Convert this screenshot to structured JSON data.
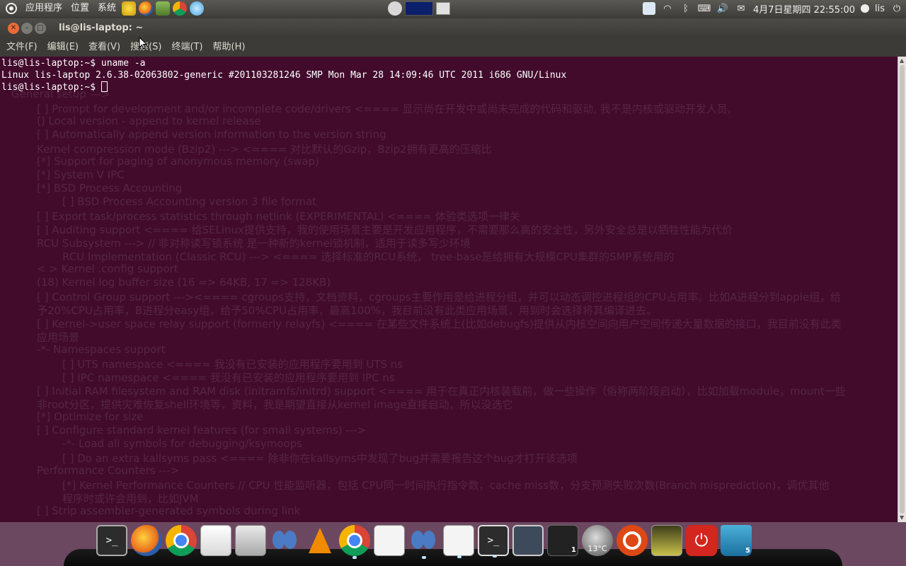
{
  "top_panel": {
    "menus": [
      "应用程序",
      "位置",
      "系统"
    ],
    "clock": "4月7日星期四 22:55:00",
    "user": "lis"
  },
  "window": {
    "title": "lis@lis-laptop: ~",
    "close_icon": "close-icon",
    "minimize_icon": "minimize-icon",
    "maximize_icon": "maximize-icon"
  },
  "menubar": {
    "items": [
      "文件(F)",
      "编辑(E)",
      "查看(V)",
      "搜索(S)",
      "终端(T)",
      "帮助(H)"
    ]
  },
  "terminal": {
    "lines": [
      "lis@lis-laptop:~$ uname -a",
      "Linux lis-laptop 2.6.38-02063802-generic #201103281246 SMP Mon Mar 28 14:09:46 UTC 2011 i686 GNU/Linux",
      "lis@lis-laptop:~$ "
    ],
    "background": "#420b2c",
    "foreground": "#ffffff"
  },
  "background_page": [
    "General setup --->",
    "[ ] Prompt for development and/or incomplete code/drivers <==== 显示尚在开发中或尚未完成的代码和驱动, 我不是内核或驱动开发人员,",
    "() Local version - append to kernel release",
    "[ ] Automatically append version information to the version string",
    "Kernel compression mode (Bzip2) ---> <==== 对比默认的Gzip，Bzip2拥有更高的压缩比",
    "[*] Support for paging of anonymous memory (swap)",
    "[*] System V IPC",
    "[*] BSD Process Accounting",
    "[ ] BSD Process Accounting version 3 file format",
    "[ ] Export task/process statistics through netlink (EXPERIMENTAL) <==== 体验类选项一律关",
    "[ ] Auditing support <==== 给SELinux提供支持，我的使用场景主要是开发应用程序，不需要那么高的安全性，另外安全总是以牺牲性能为代价",
    "RCU Subsystem ---> // 非对称读写锁系统 是一种新的kernel锁机制，适用于读多写少环境",
    "RCU Implementation (Classic RCU) ---> <==== 选择标准的RCU系统， tree-base是给拥有大规模CPU集群的SMP系统用的",
    "< > Kernel .config support",
    "(18) Kernel log buffer size (16 => 64KB, 17 => 128KB)",
    "[ ] Control Group support ---><==== cgroups支持，文档资料，cgroups主要作用是给进程分组，并可以动态调控进程组的CPU占用率。比如A进程分到apple组，给",
    "予20%CPU占用率，B进程分easy组，给予50%CPU占用率，最高100%，我目前没有此类应用场景，用到时会选择将其编译进去。",
    "[ ] Kernel->user space relay support (formerly relayfs) <==== 在某些文件系统上(比如debugfs)提供从内核空间向用户空间传递大量数据的接口，我目前没有此类",
    "应用场景",
    "-*- Namespaces support",
    "[ ] UTS namespace <==== 我没有已安装的应用程序要用到 UTS ns",
    "[ ] IPC namespace <==== 我没有已安装的应用程序要用到 IPC ns",
    "[ ] Initial RAM filesystem and RAM disk (initramfs/initrd) support <==== 用于在真正内核装载前，做一些操作（俗称两阶段启动），比如加载module，mount一些",
    "非root分区，提供灾难恢复shell环境等，资料，我是期望直接从kernel image直接启动，所以没选它",
    "[*] Optimize for size",
    "[ ] Configure standard kernel features (for small systems) --->",
    "-*- Load all symbols for debugging/ksymoops",
    "[ ] Do an extra kallsyms pass <==== 除非你在kallsyms中发现了bug并需要报告这个bug才打开该选项",
    "Performance Counters --->",
    "[*] Kernel Performance Counters // CPU 性能监听器，包括 CPU同一时间执行指令数，cache miss数，分支预测失败次数(Branch misprediction)，调优其他",
    "程序时或许会用到，比如JVM",
    "[ ] Strip assembler-generated symbols during link"
  ],
  "dock": {
    "items": [
      {
        "name": "terminal-icon",
        "label": ">_"
      },
      {
        "name": "firefox-icon"
      },
      {
        "name": "chrome-icon"
      },
      {
        "name": "mail-icon"
      },
      {
        "name": "calculator-icon"
      },
      {
        "name": "pidgin-icon"
      },
      {
        "name": "vlc-icon"
      },
      {
        "name": "chrome-window-icon"
      },
      {
        "name": "pidgin-window-icon"
      },
      {
        "name": "firefox-window-icon"
      },
      {
        "name": "terminal-window-icon"
      },
      {
        "name": "display-icon"
      },
      {
        "name": "workspace-switcher-icon",
        "badge": "1"
      },
      {
        "name": "weather-icon",
        "temperature": "13°C"
      },
      {
        "name": "ubuntu-icon"
      },
      {
        "name": "photo-icon"
      },
      {
        "name": "power-icon"
      },
      {
        "name": "trash-icon",
        "badge": "5"
      }
    ]
  },
  "colors": {
    "panel": "#3c3b37",
    "terminal_bg": "#420b2c",
    "close_button": "#e96b3a"
  }
}
